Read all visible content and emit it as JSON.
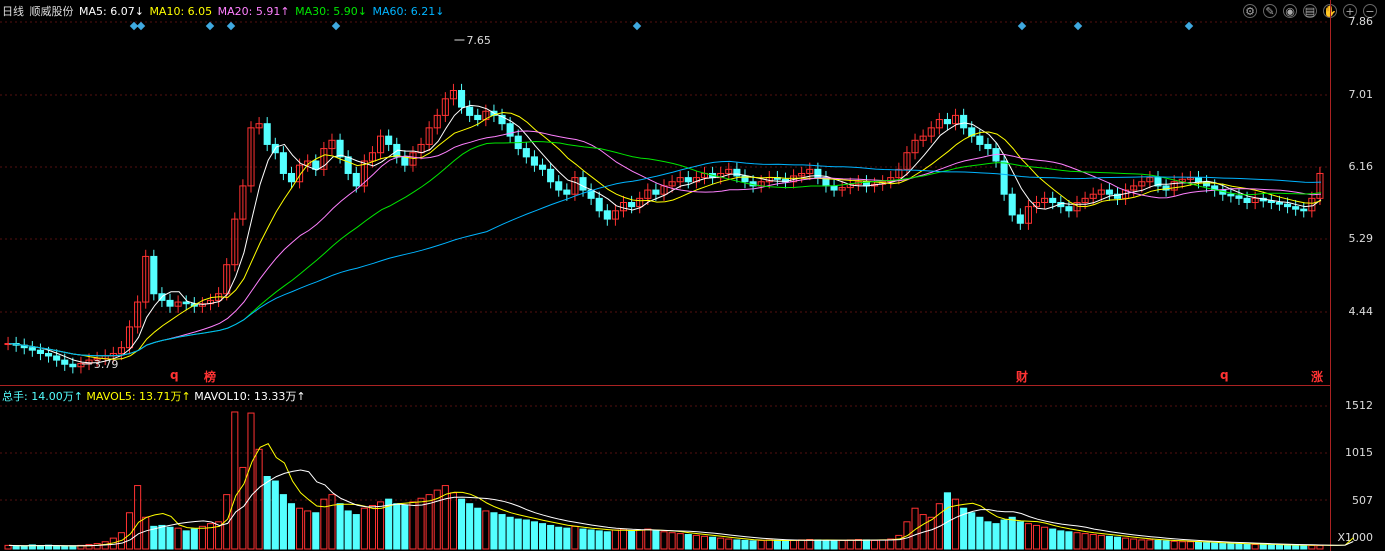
{
  "legend": {
    "period": "日线",
    "stock_name": "顺威股份",
    "ma5": "MA5: 6.07↓",
    "ma10": "MA10: 6.05",
    "ma20": "MA20: 5.91↑",
    "ma30": "MA30: 5.90↓",
    "ma60": "MA60: 6.21↓"
  },
  "volume_legend": {
    "total": "总手: 14.00万↑",
    "mavol5": "MAVOL5: 13.71万↑",
    "mavol10": "MAVOL10: 13.33万↑"
  },
  "price_axis": [
    "7.86",
    "7.01",
    "6.16",
    "5.29",
    "4.44"
  ],
  "volume_axis": [
    "1512",
    "1015",
    "507"
  ],
  "volume_unit": "X1000",
  "annotations": {
    "high": "7.65",
    "low": "3.79"
  },
  "event_markers": [
    "q",
    "榜",
    "财",
    "q",
    "涨"
  ],
  "toolbar_icons": [
    "settings-icon",
    "pen-icon",
    "eye-icon",
    "layers-icon",
    "hand-icon",
    "zoom-in-icon",
    "zoom-out-icon"
  ],
  "colors": {
    "up": "#ff3232",
    "down": "#54ffff",
    "ma5": "#ffffff",
    "ma10": "#ffff00",
    "ma20": "#ff80ff",
    "ma30": "#00e600",
    "ma60": "#00b4ff"
  },
  "chart_data": {
    "type": "candlestick",
    "price_range": [
      3.6,
      8.0
    ],
    "closes": [
      4.1,
      4.08,
      4.05,
      4.02,
      3.98,
      3.95,
      3.9,
      3.85,
      3.82,
      3.86,
      3.9,
      3.92,
      3.95,
      3.98,
      4.05,
      4.3,
      4.6,
      5.15,
      4.7,
      4.62,
      4.55,
      4.6,
      4.58,
      4.55,
      4.58,
      4.62,
      4.7,
      5.05,
      5.6,
      6.0,
      6.7,
      6.75,
      6.5,
      6.4,
      6.15,
      6.05,
      6.25,
      6.3,
      6.2,
      6.45,
      6.55,
      6.35,
      6.15,
      6.0,
      6.3,
      6.4,
      6.6,
      6.5,
      6.35,
      6.25,
      6.4,
      6.5,
      6.7,
      6.85,
      7.05,
      7.15,
      6.95,
      6.85,
      6.8,
      6.9,
      6.85,
      6.75,
      6.6,
      6.45,
      6.35,
      6.25,
      6.2,
      6.05,
      5.95,
      5.9,
      6.1,
      5.95,
      5.85,
      5.7,
      5.6,
      5.7,
      5.8,
      5.75,
      5.85,
      5.95,
      5.9,
      6.0,
      6.05,
      6.1,
      6.05,
      6.1,
      6.15,
      6.1,
      6.15,
      6.2,
      6.12,
      6.05,
      6.0,
      6.05,
      6.1,
      6.08,
      6.05,
      6.12,
      6.15,
      6.2,
      6.1,
      6.0,
      5.95,
      5.98,
      6.02,
      6.05,
      6.0,
      6.02,
      6.05,
      6.1,
      6.2,
      6.4,
      6.55,
      6.6,
      6.7,
      6.8,
      6.75,
      6.85,
      6.7,
      6.6,
      6.5,
      6.45,
      6.3,
      5.9,
      5.65,
      5.55,
      5.75,
      5.8,
      5.85,
      5.8,
      5.75,
      5.7,
      5.8,
      5.85,
      5.9,
      5.95,
      5.9,
      5.85,
      5.95,
      6.0,
      6.05,
      6.1,
      6.0,
      5.95,
      6.05,
      6.08,
      6.1,
      6.05,
      6.0,
      5.95,
      5.9,
      5.88,
      5.85,
      5.8,
      5.85,
      5.82,
      5.8,
      5.78,
      5.75,
      5.72,
      5.7,
      5.85,
      6.15
    ],
    "volumes": [
      40,
      35,
      30,
      45,
      38,
      42,
      30,
      28,
      35,
      40,
      50,
      60,
      80,
      120,
      180,
      400,
      700,
      350,
      250,
      260,
      240,
      230,
      200,
      220,
      250,
      280,
      300,
      600,
      1512,
      900,
      1500,
      1100,
      800,
      750,
      600,
      500,
      450,
      420,
      400,
      550,
      600,
      500,
      420,
      380,
      450,
      480,
      520,
      550,
      500,
      480,
      520,
      560,
      600,
      650,
      700,
      620,
      550,
      500,
      450,
      420,
      400,
      380,
      350,
      330,
      320,
      300,
      280,
      260,
      240,
      230,
      250,
      220,
      210,
      200,
      190,
      210,
      220,
      200,
      210,
      220,
      200,
      190,
      180,
      170,
      160,
      150,
      140,
      130,
      120,
      110,
      100,
      95,
      90,
      95,
      100,
      95,
      90,
      95,
      100,
      105,
      100,
      95,
      90,
      95,
      100,
      105,
      100,
      95,
      100,
      110,
      150,
      300,
      450,
      380,
      350,
      500,
      620,
      550,
      450,
      400,
      350,
      300,
      280,
      320,
      350,
      300,
      280,
      260,
      240,
      220,
      200,
      190,
      180,
      170,
      160,
      150,
      140,
      130,
      120,
      110,
      100,
      100,
      95,
      90,
      85,
      80,
      80,
      75,
      70,
      65,
      60,
      55,
      60,
      55,
      50,
      48,
      45,
      42,
      40,
      45,
      42,
      40,
      38,
      36,
      40,
      60,
      450
    ]
  }
}
